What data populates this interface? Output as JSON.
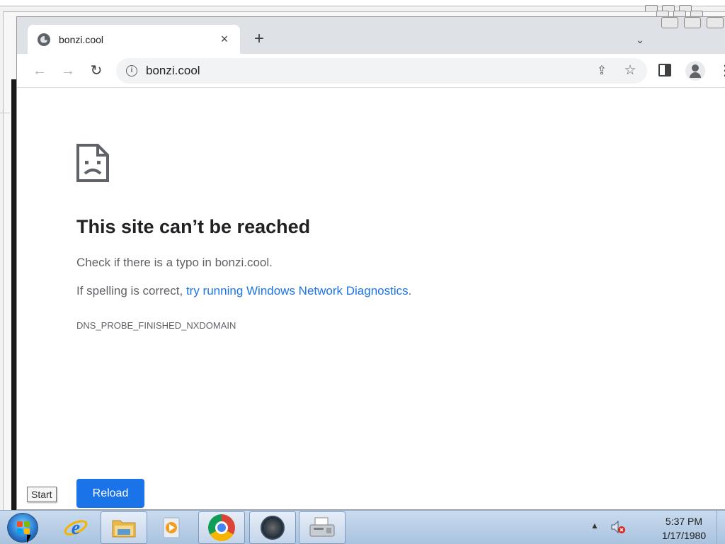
{
  "browser": {
    "tab": {
      "title": "bonzi.cool",
      "favicon": "globe-icon",
      "close": "×"
    },
    "new_tab": "+",
    "tab_search": "⌄",
    "toolbar": {
      "back": "←",
      "forward": "→",
      "reload": "↻",
      "url": "bonzi.cool",
      "site_info": "i",
      "share": "⇪",
      "bookmark": "☆",
      "menu": "⋮"
    }
  },
  "error_page": {
    "title": "This site can’t be reached",
    "check_typo": "Check if there is a typo in bonzi.cool.",
    "spelling_prefix": "If spelling is correct, ",
    "diagnostics_link": "try running Windows Network Diagnostics",
    "spelling_suffix": ".",
    "error_code": "DNS_PROBE_FINISHED_NXDOMAIN",
    "reload_button": "Reload",
    "accent_color": "#1a73e8"
  },
  "tooltip": {
    "start": "Start"
  },
  "taskbar": {
    "apps": [
      {
        "name": "Internet Explorer",
        "icon": "ie-icon"
      },
      {
        "name": "Windows Explorer",
        "icon": "folder-icon"
      },
      {
        "name": "Media Player",
        "icon": "media-icon"
      },
      {
        "name": "Google Chrome",
        "icon": "chrome-icon"
      },
      {
        "name": "Monitor",
        "icon": "monitor-icon"
      },
      {
        "name": "Fax",
        "icon": "fax-icon"
      }
    ],
    "tray_arrow": "▲",
    "clock": {
      "time": "5:37 PM",
      "date": "1/17/1980"
    }
  }
}
